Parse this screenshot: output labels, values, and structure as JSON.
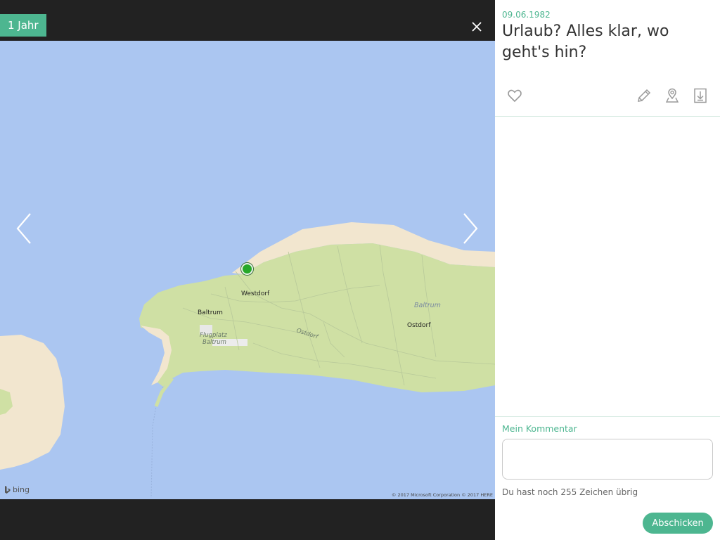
{
  "viewer": {
    "badge": "1 Jahr",
    "map": {
      "labels": {
        "westdorf": "Westdorf",
        "baltrum_village": "Baltrum",
        "airport_line1": "Flugplatz",
        "airport_line2": "Baltrum",
        "ostdorf_road": "Ostdorf",
        "baltrum_island": "Baltrum",
        "ostdorf": "Ostdorf"
      },
      "bing": "bing",
      "copyright": "© 2017 Microsoft Corporation © 2017 HERE"
    }
  },
  "panel": {
    "date": "09.06.1982",
    "title": "Urlaub? Alles klar, wo geht's hin?",
    "comment": {
      "label": "Mein Kommentar",
      "value": "",
      "counter": "Du hast noch 255 Zeichen übrig",
      "submit": "Abschicken"
    }
  },
  "colors": {
    "accent": "#4db690",
    "water": "#abc6f1",
    "land": "#cfe0a4",
    "beach": "#f2e6cf"
  }
}
